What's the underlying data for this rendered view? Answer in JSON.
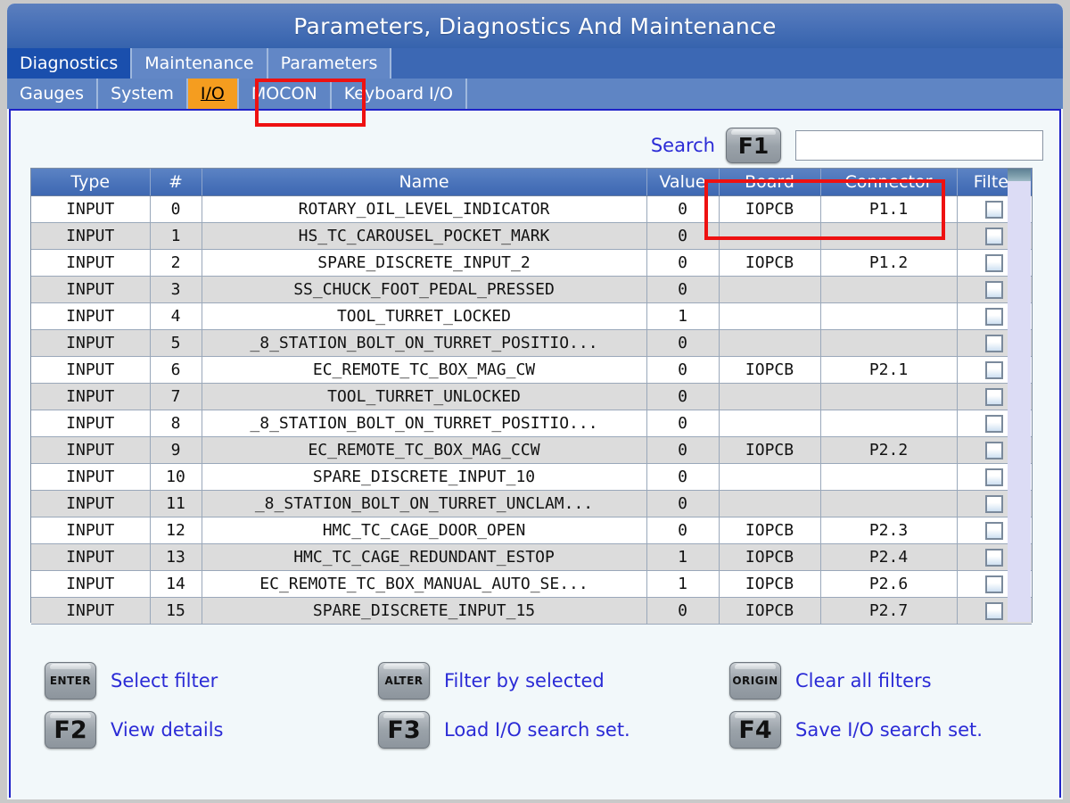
{
  "window": {
    "title": "Parameters, Diagnostics And Maintenance"
  },
  "tabs": {
    "primary": [
      {
        "label": "Diagnostics",
        "active": true
      },
      {
        "label": "Maintenance",
        "active": false
      },
      {
        "label": "Parameters",
        "active": false
      }
    ],
    "secondary": [
      {
        "label": "Gauges",
        "active": false
      },
      {
        "label": "System",
        "active": false
      },
      {
        "label": "I/O",
        "active": true
      },
      {
        "label": "MOCON",
        "active": false
      },
      {
        "label": "Keyboard I/O",
        "active": false
      }
    ]
  },
  "search": {
    "label": "Search",
    "key": "F1",
    "value": "",
    "placeholder": ""
  },
  "table": {
    "columns": [
      "Type",
      "#",
      "Name",
      "Value",
      "Board",
      "Connector",
      "Filter"
    ],
    "rows": [
      {
        "type": "INPUT",
        "num": "0",
        "name": "ROTARY_OIL_LEVEL_INDICATOR",
        "value": "0",
        "board": "IOPCB",
        "connector": "P1.1",
        "filter": false
      },
      {
        "type": "INPUT",
        "num": "1",
        "name": "HS_TC_CAROUSEL_POCKET_MARK",
        "value": "0",
        "board": "",
        "connector": "",
        "filter": false
      },
      {
        "type": "INPUT",
        "num": "2",
        "name": "SPARE_DISCRETE_INPUT_2",
        "value": "0",
        "board": "IOPCB",
        "connector": "P1.2",
        "filter": false
      },
      {
        "type": "INPUT",
        "num": "3",
        "name": "SS_CHUCK_FOOT_PEDAL_PRESSED",
        "value": "0",
        "board": "",
        "connector": "",
        "filter": false
      },
      {
        "type": "INPUT",
        "num": "4",
        "name": "TOOL_TURRET_LOCKED",
        "value": "1",
        "board": "",
        "connector": "",
        "filter": false
      },
      {
        "type": "INPUT",
        "num": "5",
        "name": "_8_STATION_BOLT_ON_TURRET_POSITIO...",
        "value": "0",
        "board": "",
        "connector": "",
        "filter": false
      },
      {
        "type": "INPUT",
        "num": "6",
        "name": "EC_REMOTE_TC_BOX_MAG_CW",
        "value": "0",
        "board": "IOPCB",
        "connector": "P2.1",
        "filter": false
      },
      {
        "type": "INPUT",
        "num": "7",
        "name": "TOOL_TURRET_UNLOCKED",
        "value": "0",
        "board": "",
        "connector": "",
        "filter": false
      },
      {
        "type": "INPUT",
        "num": "8",
        "name": "_8_STATION_BOLT_ON_TURRET_POSITIO...",
        "value": "0",
        "board": "",
        "connector": "",
        "filter": false
      },
      {
        "type": "INPUT",
        "num": "9",
        "name": "EC_REMOTE_TC_BOX_MAG_CCW",
        "value": "0",
        "board": "IOPCB",
        "connector": "P2.2",
        "filter": false
      },
      {
        "type": "INPUT",
        "num": "10",
        "name": "SPARE_DISCRETE_INPUT_10",
        "value": "0",
        "board": "",
        "connector": "",
        "filter": false
      },
      {
        "type": "INPUT",
        "num": "11",
        "name": "_8_STATION_BOLT_ON_TURRET_UNCLAM...",
        "value": "0",
        "board": "",
        "connector": "",
        "filter": false
      },
      {
        "type": "INPUT",
        "num": "12",
        "name": "HMC_TC_CAGE_DOOR_OPEN",
        "value": "0",
        "board": "IOPCB",
        "connector": "P2.3",
        "filter": false
      },
      {
        "type": "INPUT",
        "num": "13",
        "name": "HMC_TC_CAGE_REDUNDANT_ESTOP",
        "value": "1",
        "board": "IOPCB",
        "connector": "P2.4",
        "filter": false
      },
      {
        "type": "INPUT",
        "num": "14",
        "name": "EC_REMOTE_TC_BOX_MANUAL_AUTO_SE...",
        "value": "1",
        "board": "IOPCB",
        "connector": "P2.6",
        "filter": false
      },
      {
        "type": "INPUT",
        "num": "15",
        "name": "SPARE_DISCRETE_INPUT_15",
        "value": "0",
        "board": "IOPCB",
        "connector": "P2.7",
        "filter": false
      }
    ]
  },
  "footer": {
    "actions": [
      {
        "key": "ENTER",
        "label": "Select filter"
      },
      {
        "key": "F2",
        "label": "View details"
      },
      {
        "key": "ALTER",
        "label": "Filter by selected"
      },
      {
        "key": "F3",
        "label": "Load I/O search set."
      },
      {
        "key": "ORIGIN",
        "label": "Clear all filters"
      },
      {
        "key": "F4",
        "label": "Save I/O search set."
      }
    ]
  },
  "colors": {
    "title_bar": "#4a72b8",
    "tab_active_primary": "#1a4fad",
    "tab_active_secondary": "#f59d1f",
    "panel_border": "#1f22c8",
    "link_text": "#2b2bd6",
    "annotation": "#ee1111",
    "row_odd": "#dcdcdc",
    "row_even": "#ffffff",
    "header_blue": "#4a73ba",
    "scrollbar_track": "#dcdcf5"
  }
}
